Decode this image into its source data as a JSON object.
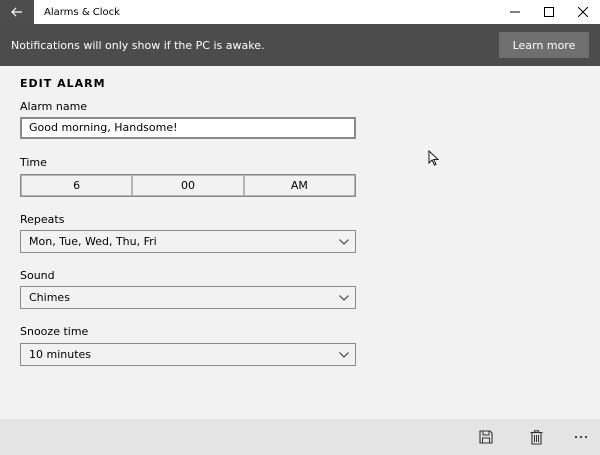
{
  "window": {
    "title": "Alarms & Clock"
  },
  "banner": {
    "message": "Notifications will only show if the PC is awake.",
    "button_label": "Learn more"
  },
  "edit_alarm": {
    "heading": "EDIT ALARM",
    "alarm_name_label": "Alarm name",
    "alarm_name_value": "Good morning, Handsome!",
    "time_label": "Time",
    "time": {
      "hour": "6",
      "minute": "00",
      "period": "AM"
    },
    "repeats_label": "Repeats",
    "repeats_value": "Mon, Tue, Wed, Thu, Fri",
    "sound_label": "Sound",
    "sound_value": "Chimes",
    "snooze_label": "Snooze time",
    "snooze_value": "10 minutes"
  },
  "icons": {
    "back": "back-arrow-icon",
    "minimize": "minimize-icon",
    "maximize": "maximize-icon",
    "close": "close-icon",
    "save": "save-icon",
    "delete": "delete-icon",
    "more": "more-icon",
    "chevron": "chevron-down-icon",
    "cursor": "mouse-cursor-icon"
  },
  "colors": {
    "banner_bg": "#4c4c4c",
    "learn_more_bg": "#6f6f6f",
    "page_bg": "#f2f2f2",
    "bottom_bar_bg": "#e4e4e4"
  }
}
